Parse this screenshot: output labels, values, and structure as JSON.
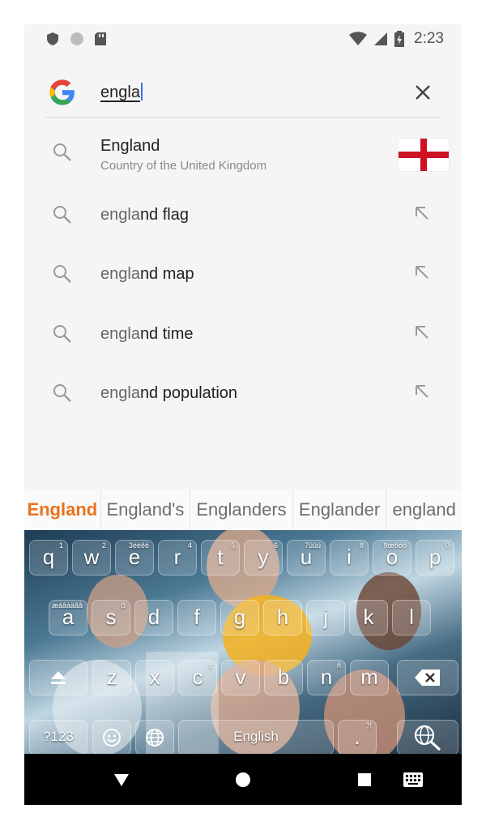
{
  "status_bar": {
    "time": "2:23",
    "icons": [
      "shield-icon",
      "circle-icon",
      "sd-card-icon",
      "wifi-icon",
      "signal-icon",
      "battery-icon"
    ]
  },
  "search": {
    "query": "engla",
    "clear_icon": "close-icon"
  },
  "suggestions": [
    {
      "prefix": "",
      "rest": "England",
      "subtitle": "Country of the United Kingdom",
      "has_flag": true
    },
    {
      "prefix": "engla",
      "rest": "nd flag"
    },
    {
      "prefix": "engla",
      "rest": "nd map"
    },
    {
      "prefix": "engla",
      "rest": "nd time"
    },
    {
      "prefix": "engla",
      "rest": "nd population"
    }
  ],
  "keyboard": {
    "word_suggestions": [
      "England",
      "England's",
      "Englanders",
      "Englander",
      "england"
    ],
    "row1": [
      {
        "k": "q",
        "s": "1"
      },
      {
        "k": "w",
        "s": "2"
      },
      {
        "k": "e",
        "s": "3èéêë"
      },
      {
        "k": "r",
        "s": "4"
      },
      {
        "k": "t",
        "s": "5"
      },
      {
        "k": "y",
        "s": "6"
      },
      {
        "k": "u",
        "s": "7üûú"
      },
      {
        "k": "i",
        "s": "8"
      },
      {
        "k": "o",
        "s": "9œôóö"
      },
      {
        "k": "p",
        "s": "0"
      }
    ],
    "row2": [
      {
        "k": "a",
        "s": "æáâàäãå"
      },
      {
        "k": "s",
        "s": "ß"
      },
      {
        "k": "d",
        "s": ""
      },
      {
        "k": "f",
        "s": ""
      },
      {
        "k": "g",
        "s": ""
      },
      {
        "k": "h",
        "s": ""
      },
      {
        "k": "j",
        "s": ""
      },
      {
        "k": "k",
        "s": ""
      },
      {
        "k": "l",
        "s": ""
      }
    ],
    "row3": [
      {
        "k": "z",
        "s": ""
      },
      {
        "k": "x",
        "s": ""
      },
      {
        "k": "c",
        "s": "ç"
      },
      {
        "k": "v",
        "s": ""
      },
      {
        "k": "b",
        "s": ""
      },
      {
        "k": "n",
        "s": "ñ"
      },
      {
        "k": "m",
        "s": ""
      }
    ],
    "symbols_label": "?123",
    "space_label": "English",
    "period_label": ".",
    "period_sup": "?!"
  },
  "colors": {
    "accent_orange": "#e8721c",
    "flag_red": "#ce1124",
    "caret_blue": "#3d6df2"
  }
}
